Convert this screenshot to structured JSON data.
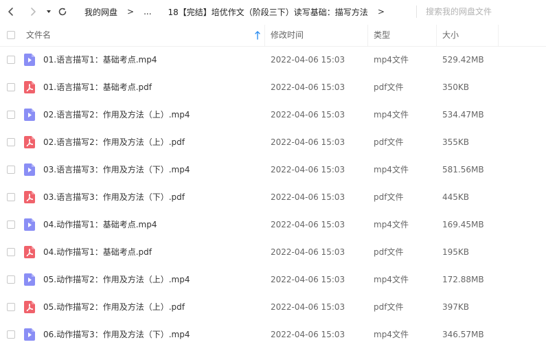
{
  "toolbar": {
    "breadcrumb": {
      "root": "我的网盘",
      "ellipsis": "...",
      "current": "18【完结】培优作文（阶段三下）读写基础：描写方法",
      "separator": ">"
    },
    "search_placeholder": "搜索我的网盘文件"
  },
  "header": {
    "name": "文件名",
    "modified": "修改时间",
    "type": "类型",
    "size": "大小"
  },
  "icons": {
    "back": "chevron-left-icon",
    "forward": "chevron-right-icon",
    "history": "caret-down-icon",
    "refresh": "refresh-icon",
    "sort": "sort-up-arrow-icon",
    "mp4": "video-file-icon",
    "pdf": "pdf-file-icon"
  },
  "colors": {
    "mp4_icon": "#8a8ef5",
    "pdf_icon": "#f0626b",
    "sort_arrow": "#2e8ef0"
  },
  "files": [
    {
      "name": "01.语言描写1：基础考点.mp4",
      "modified": "2022-04-06 15:03",
      "type": "mp4文件",
      "size": "529.42MB",
      "kind": "mp4"
    },
    {
      "name": "01.语言描写1：基础考点.pdf",
      "modified": "2022-04-06 15:03",
      "type": "pdf文件",
      "size": "350KB",
      "kind": "pdf"
    },
    {
      "name": "02.语言描写2：作用及方法（上）.mp4",
      "modified": "2022-04-06 15:03",
      "type": "mp4文件",
      "size": "534.47MB",
      "kind": "mp4"
    },
    {
      "name": "02.语言描写2：作用及方法（上）.pdf",
      "modified": "2022-04-06 15:03",
      "type": "pdf文件",
      "size": "355KB",
      "kind": "pdf"
    },
    {
      "name": "03.语言描写3：作用及方法（下）.mp4",
      "modified": "2022-04-06 15:03",
      "type": "mp4文件",
      "size": "581.56MB",
      "kind": "mp4"
    },
    {
      "name": "03.语言描写3：作用及方法（下）.pdf",
      "modified": "2022-04-06 15:03",
      "type": "pdf文件",
      "size": "445KB",
      "kind": "pdf"
    },
    {
      "name": "04.动作描写1：基础考点.mp4",
      "modified": "2022-04-06 15:03",
      "type": "mp4文件",
      "size": "169.45MB",
      "kind": "mp4"
    },
    {
      "name": "04.动作描写1：基础考点.pdf",
      "modified": "2022-04-06 15:03",
      "type": "pdf文件",
      "size": "195KB",
      "kind": "pdf"
    },
    {
      "name": "05.动作描写2：作用及方法（上）.mp4",
      "modified": "2022-04-06 15:03",
      "type": "mp4文件",
      "size": "172.88MB",
      "kind": "mp4"
    },
    {
      "name": "05.动作描写2：作用及方法（上）.pdf",
      "modified": "2022-04-06 15:03",
      "type": "pdf文件",
      "size": "397KB",
      "kind": "pdf"
    },
    {
      "name": "06.动作描写3：作用及方法（下）.mp4",
      "modified": "2022-04-06 15:03",
      "type": "mp4文件",
      "size": "346.57MB",
      "kind": "mp4"
    }
  ]
}
